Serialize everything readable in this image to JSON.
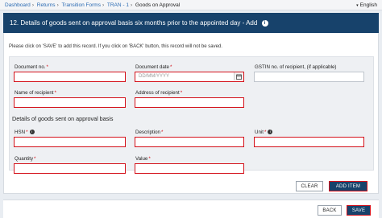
{
  "breadcrumb": {
    "items": [
      "Dashboard",
      "Returns",
      "Transition Forms",
      "TRAN - 1",
      "Goods on Approval"
    ],
    "separator": "›"
  },
  "language": {
    "label": "English",
    "caret": "▾"
  },
  "header": {
    "title": "12. Details of goods sent on approval basis six months prior to the appointed day - Add",
    "info_icon": "i"
  },
  "notice": "Please click on 'SAVE' to add this record. If you click on 'BACK' button, this record will not be saved.",
  "form": {
    "document_no": {
      "label": "Document no.",
      "value": ""
    },
    "document_date": {
      "label": "Document date",
      "placeholder": "DD/MM/YYYY",
      "icon": "calendar-icon"
    },
    "gstin": {
      "label": "GSTIN no. of recipient, (if applicable)",
      "value": ""
    },
    "recipient_name": {
      "label": "Name of recipient",
      "value": ""
    },
    "recipient_address": {
      "label": "Address of recipient",
      "value": ""
    },
    "section_title": "Details of goods sent on approval basis",
    "hsn": {
      "label": "HSN",
      "value": ""
    },
    "description": {
      "label": "Description",
      "value": ""
    },
    "unit": {
      "label": "Unit",
      "value": ""
    },
    "quantity": {
      "label": "Quantity",
      "value": ""
    },
    "value": {
      "label": "Value",
      "value": ""
    },
    "required_mark": "*",
    "info_mark": "i"
  },
  "buttons": {
    "clear": "CLEAR",
    "add_item": "ADD ITEM",
    "back": "BACK",
    "save": "SAVE"
  },
  "colors": {
    "header_bg": "#17426b",
    "required": "#d4111a",
    "link": "#2a6ab3"
  }
}
